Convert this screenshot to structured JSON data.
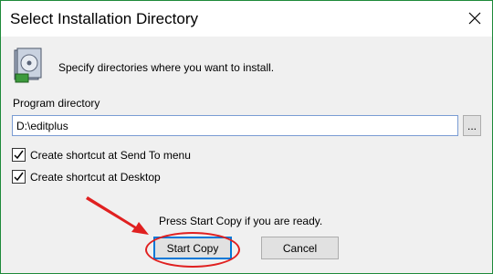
{
  "window": {
    "title": "Select Installation Directory",
    "close_icon": "close-icon"
  },
  "header": {
    "icon": "installer-icon",
    "text": "Specify directories where you want to install."
  },
  "program_directory": {
    "label": "Program directory",
    "value": "D:\\editplus",
    "browse_label": "..."
  },
  "options": [
    {
      "label": "Create shortcut at Send To menu",
      "checked": true
    },
    {
      "label": "Create shortcut at Desktop",
      "checked": true
    }
  ],
  "footer": {
    "ready_text": "Press Start Copy if you are ready.",
    "start_label": "Start Copy",
    "cancel_label": "Cancel"
  },
  "annotation": {
    "color": "#e02020"
  },
  "colors": {
    "accent": "#0078d7",
    "window_border": "#1e8a3a"
  }
}
